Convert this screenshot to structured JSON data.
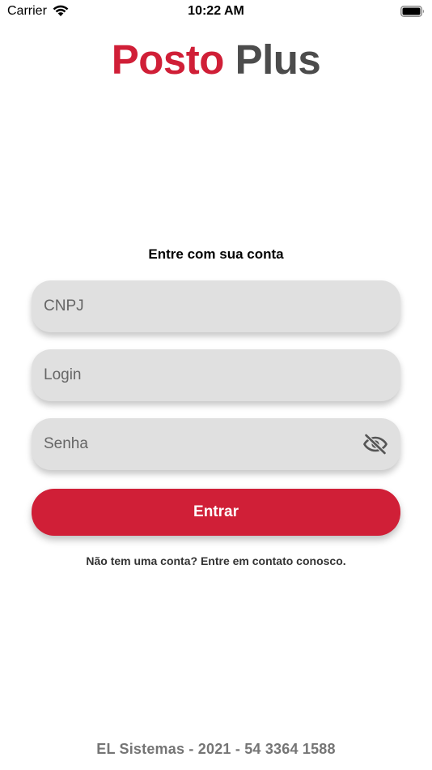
{
  "status_bar": {
    "carrier": "Carrier",
    "time": "10:22 AM",
    "icons": [
      "wifi-icon",
      "battery-icon"
    ]
  },
  "logo": {
    "word_1": "Posto",
    "word_2": "Plus",
    "colors": {
      "word_1": "#d01f37",
      "word_2": "#4c4c4c"
    }
  },
  "form": {
    "title": "Entre com sua conta",
    "cnpj": {
      "placeholder": "CNPJ",
      "value": ""
    },
    "login": {
      "placeholder": "Login",
      "value": ""
    },
    "senha": {
      "placeholder": "Senha",
      "value": "",
      "toggle_icon": "eye-off-icon"
    },
    "submit_label": "Entrar",
    "signup_text": "Não tem uma conta? Entre em contato conosco."
  },
  "footer": {
    "text": "EL Sistemas - 2021 - 54 3364 1588"
  },
  "colors": {
    "accent": "#d01f37",
    "field_bg": "#e0e0e0",
    "footer_text": "#757575"
  }
}
